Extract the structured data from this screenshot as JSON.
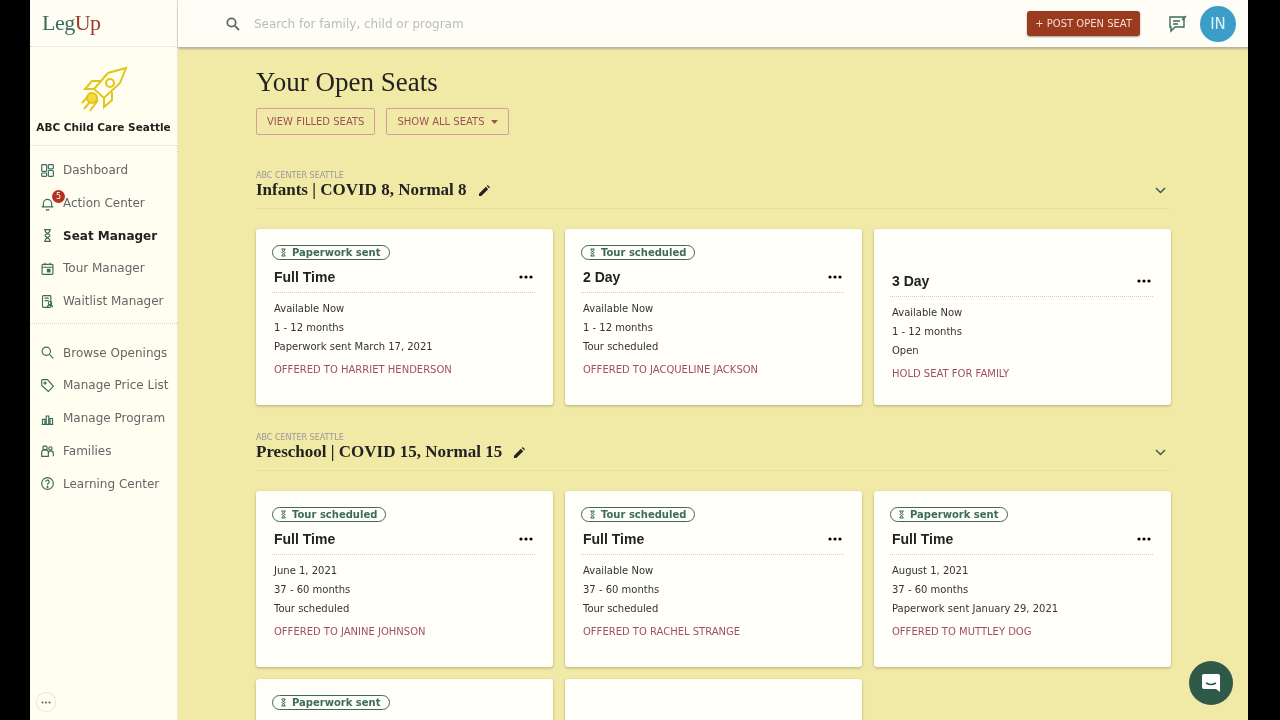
{
  "logo": {
    "first": "Leg",
    "second": "Up"
  },
  "search": {
    "placeholder": "Search for family, child or program"
  },
  "post_button": {
    "icon": "+",
    "label": "POST OPEN SEAT"
  },
  "avatar": {
    "initials": "IN"
  },
  "provider": {
    "name": "ABC Child Care Seattle"
  },
  "sidebar": {
    "groups": [
      [
        {
          "label": "Dashboard",
          "selected": false
        },
        {
          "label": "Action Center",
          "selected": false,
          "badge": "5"
        },
        {
          "label": "Seat Manager",
          "selected": true
        },
        {
          "label": "Tour Manager",
          "selected": false
        },
        {
          "label": "Waitlist Manager",
          "selected": false
        }
      ],
      [
        {
          "label": "Browse Openings",
          "selected": false
        },
        {
          "label": "Manage Price List",
          "selected": false
        },
        {
          "label": "Manage Program",
          "selected": false
        },
        {
          "label": "Families",
          "selected": false
        },
        {
          "label": "Learning Center",
          "selected": false
        }
      ]
    ]
  },
  "page": {
    "title": "Your Open Seats",
    "buttons": [
      {
        "label": "VIEW FILLED SEATS",
        "kind": "plain"
      },
      {
        "label": "SHOW ALL SEATS",
        "kind": "dropdown"
      }
    ]
  },
  "sections": [
    {
      "center": "ABC CENTER SEATTLE",
      "title": "Infants | COVID 8, Normal 8",
      "cards": [
        {
          "badge": "Paperwork sent",
          "title": "Full Time",
          "lines": [
            "Available Now",
            "1 - 12 months",
            "Paperwork sent March 17, 2021"
          ],
          "action": "OFFERED TO HARRIET HENDERSON"
        },
        {
          "badge": "Tour scheduled",
          "title": "2 Day",
          "lines": [
            "Available Now",
            "1 - 12 months",
            "Tour scheduled"
          ],
          "action": "OFFERED TO JACQUELINE JACKSON"
        },
        {
          "title": "3 Day",
          "lines": [
            "Available Now",
            "1 - 12 months",
            "Open"
          ],
          "action": "HOLD SEAT FOR FAMILY"
        }
      ]
    },
    {
      "center": "ABC CENTER SEATTLE",
      "title": "Preschool | COVID 15, Normal 15",
      "cards": [
        {
          "badge": "Tour scheduled",
          "title": "Full Time",
          "lines": [
            "June 1, 2021",
            "37 - 60 months",
            "Tour scheduled"
          ],
          "action": "OFFERED TO JANINE JOHNSON"
        },
        {
          "badge": "Tour scheduled",
          "title": "Full Time",
          "lines": [
            "Available Now",
            "37 - 60 months",
            "Tour scheduled"
          ],
          "action": "OFFERED TO RACHEL STRANGE"
        },
        {
          "badge": "Paperwork sent",
          "title": "Full Time",
          "lines": [
            "August 1, 2021",
            "37 - 60 months",
            "Paperwork sent January 29, 2021"
          ],
          "action": "OFFERED TO MUTTLEY DOG"
        },
        {
          "kind": "seat",
          "badge": "Paperwork sent"
        },
        {
          "kind": "blank"
        }
      ]
    }
  ]
}
